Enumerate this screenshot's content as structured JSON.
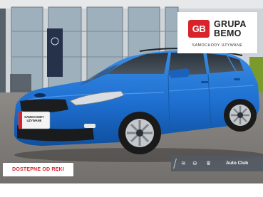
{
  "dealer": {
    "logo_mark": "GB",
    "name_line1": "GRUPA",
    "name_line2": "BEMO",
    "tagline": "SAMOCHODY UŻYWANE"
  },
  "badge": {
    "availability": "DOSTĘPNE OD RĘKI"
  },
  "partners": {
    "label": "Auto Club",
    "icons": [
      "citroen-icon",
      "opel-icon",
      "peugeot-icon"
    ]
  },
  "plate": {
    "line1": "SAMOCHODY",
    "line2": "UŻYWANE"
  },
  "colors": {
    "car_body": "#1e6fd0",
    "brand_red": "#d8232a",
    "partner_bar": "#545a63"
  }
}
